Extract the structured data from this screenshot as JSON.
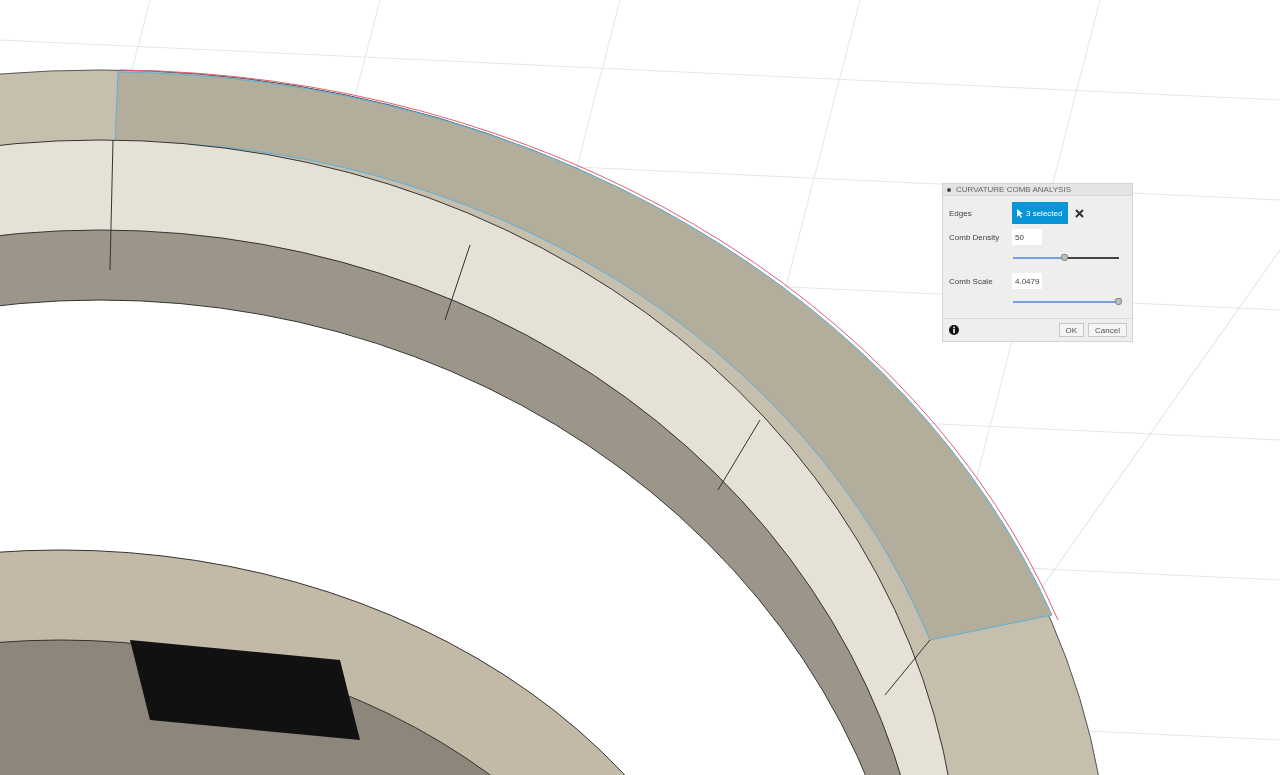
{
  "dialog": {
    "title": "CURVATURE COMB ANALYSIS",
    "rows": [
      {
        "kind": "selection",
        "label": "Edges",
        "value": "3 selected"
      },
      {
        "kind": "number",
        "label": "Comb Density",
        "value": "50",
        "level": 0.49
      },
      {
        "kind": "number",
        "label": "Comb Scale",
        "value": "4.0479",
        "level": 1
      }
    ],
    "buttons": [
      "OK",
      "Cancel"
    ]
  }
}
